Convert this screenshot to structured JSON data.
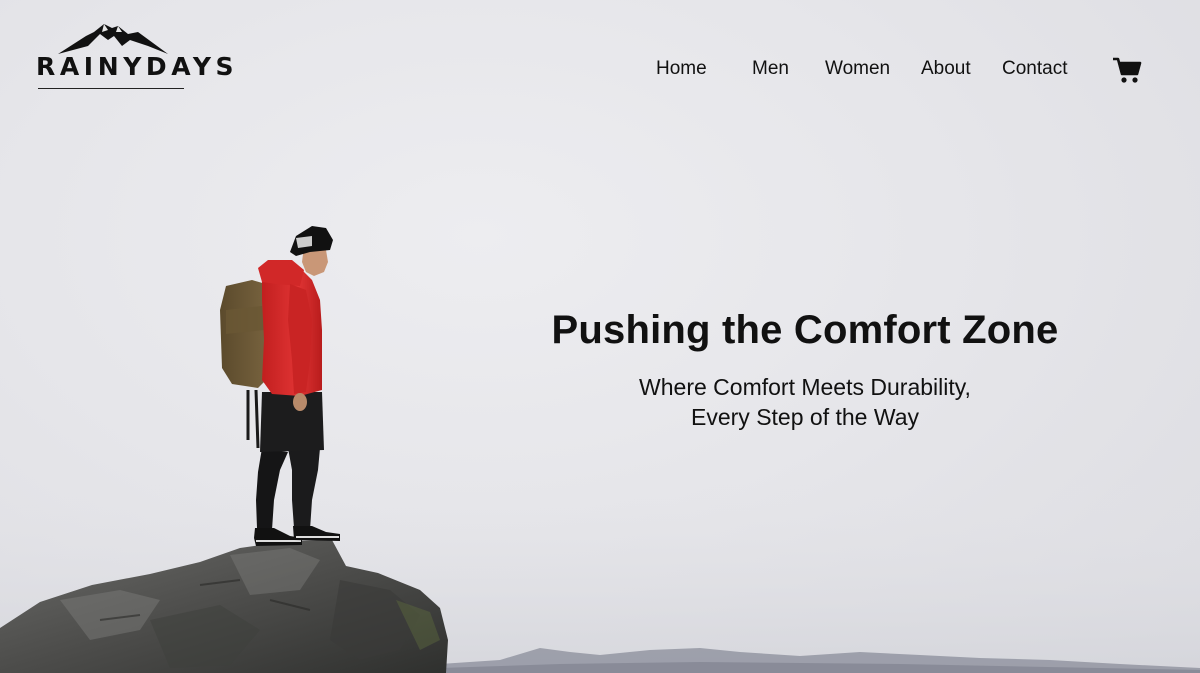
{
  "brand": {
    "name": "RAINYDAYS",
    "logo_icon": "mountain-icon"
  },
  "nav": {
    "items": [
      {
        "label": "Home"
      },
      {
        "label": "Men"
      },
      {
        "label": "Women"
      },
      {
        "label": "About"
      },
      {
        "label": "Contact"
      }
    ],
    "cart_icon": "cart-icon"
  },
  "hero": {
    "title": "Pushing the Comfort Zone",
    "subtitle_line1": "Where Comfort Meets Durability,",
    "subtitle_line2": "Every Step of the Way",
    "image_subject": "hiker-on-rock"
  },
  "colors": {
    "text": "#111111",
    "background": "#e6e6ea",
    "jacket": "#d92b2b"
  }
}
